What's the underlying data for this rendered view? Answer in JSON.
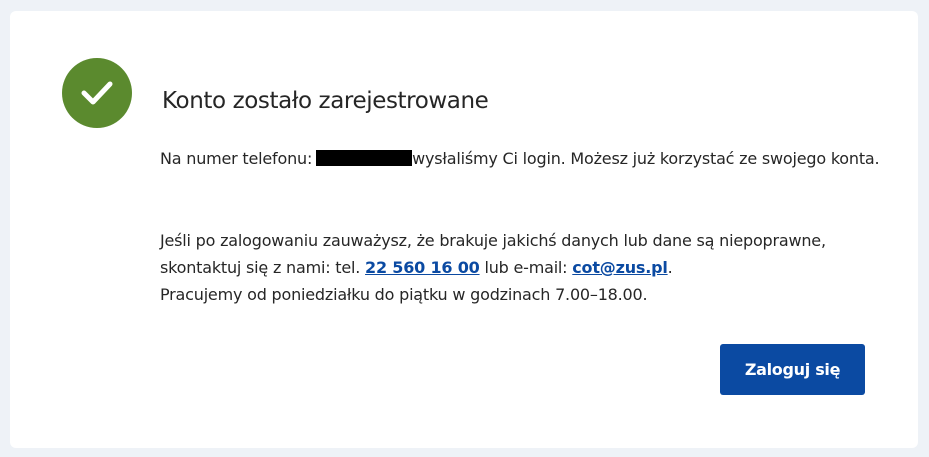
{
  "colors": {
    "background": "#eef2f7",
    "card": "#ffffff",
    "success": "#5b8a2e",
    "primary": "#0b4aa2",
    "text": "#262626"
  },
  "status": {
    "icon": "check-icon"
  },
  "title": "Konto zostało zarejestrowane",
  "message": {
    "phone_prefix": "Na numer telefonu:",
    "phone_masked": "",
    "phone_suffix": "wysłaliśmy Ci login. Możesz już korzystać ze swojego konta."
  },
  "contact": {
    "intro": "Jeśli po zalogowaniu zauważysz, że brakuje jakichś danych lub dane są niepoprawne, skontaktuj się z nami: tel.",
    "phone": "22 560 16 00",
    "or_email": "lub e-mail:",
    "email": "cot@zus.pl",
    "period": ".",
    "hours": "Pracujemy od poniedziałku do piątku w godzinach 7.00–18.00."
  },
  "actions": {
    "login_label": "Zaloguj się"
  }
}
